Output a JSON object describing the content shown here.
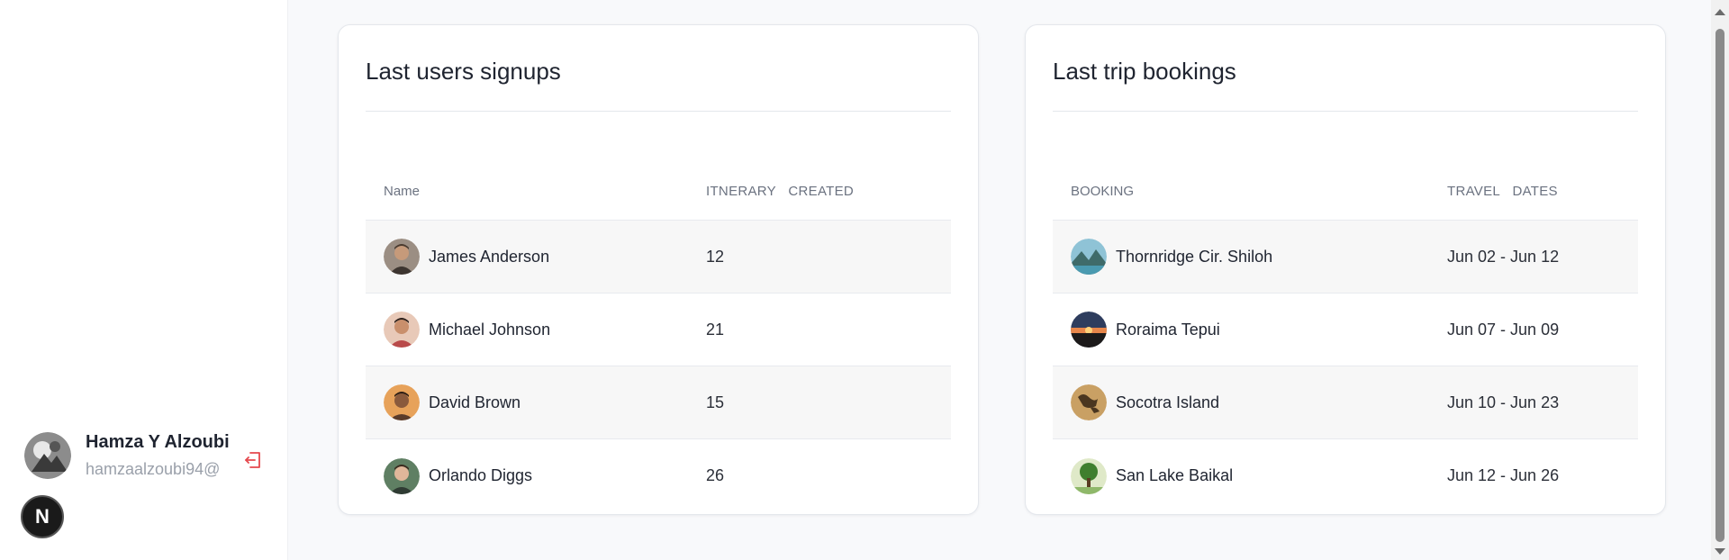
{
  "sidebar": {
    "user": {
      "name": "Hamza Y Alzoubi",
      "email": "hamzaalzoubi94@"
    },
    "logout_icon": "logout-icon",
    "badge_label": "N"
  },
  "users_card": {
    "title": "Last users signups",
    "columns": {
      "name": "Name",
      "itinerary": "ITNERARY",
      "created": "CREATED"
    },
    "rows": [
      {
        "name": "James Anderson",
        "value": "12"
      },
      {
        "name": "Michael Johnson",
        "value": "21"
      },
      {
        "name": "David Brown",
        "value": "15"
      },
      {
        "name": "Orlando Diggs",
        "value": "26"
      }
    ]
  },
  "trips_card": {
    "title": "Last trip bookings",
    "columns": {
      "booking": "BOOKING",
      "travel": "TRAVEL",
      "dates": "DATES"
    },
    "rows": [
      {
        "name": "Thornridge Cir. Shiloh",
        "dates": "Jun 02 - Jun 12"
      },
      {
        "name": "Roraima Tepui",
        "dates": "Jun 07 - Jun 09"
      },
      {
        "name": "Socotra Island",
        "dates": "Jun 10 - Jun 23"
      },
      {
        "name": "San Lake Baikal",
        "dates": "Jun 12 - Jun 26"
      }
    ]
  },
  "colors": {
    "logout": "#e5484d",
    "badge_bg": "#1a1a1a",
    "row_alt": "#f7f7f7"
  }
}
